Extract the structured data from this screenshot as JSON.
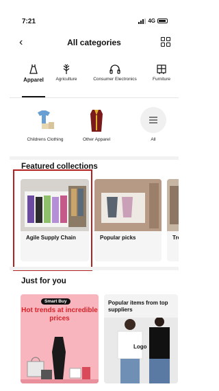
{
  "status_bar": {
    "time": "7:21",
    "network": "4G"
  },
  "header": {
    "title": "All categories",
    "back_glyph": "‹"
  },
  "tabs": [
    {
      "label": "Apparel",
      "icon": "dress-icon",
      "active": true
    },
    {
      "label": "Agriculture",
      "icon": "leaf-icon",
      "active": false
    },
    {
      "label": "Consumer Electronics",
      "icon": "headphones-icon",
      "active": false
    },
    {
      "label": "Furniture",
      "icon": "furniture-icon",
      "active": false
    }
  ],
  "subcategories": [
    {
      "label": "Childrens Clothing"
    },
    {
      "label": "Other Apparel"
    },
    {
      "label": "All"
    }
  ],
  "featured": {
    "title": "Featured collections",
    "cards": [
      {
        "label": "Agile Supply Chain"
      },
      {
        "label": "Popular picks"
      },
      {
        "label": "Tre"
      }
    ]
  },
  "just_for_you": {
    "title": "Just for you",
    "promo": {
      "chip": "Smart Buy",
      "text": "Hot trends at incredible prices"
    },
    "suppliers": {
      "caption": "Popular items from top suppliers",
      "logo_text": "Logo"
    }
  },
  "colors": {
    "accent_red": "#d8232a",
    "highlight_border": "#b32020",
    "promo_bg": "#f8b5be"
  }
}
